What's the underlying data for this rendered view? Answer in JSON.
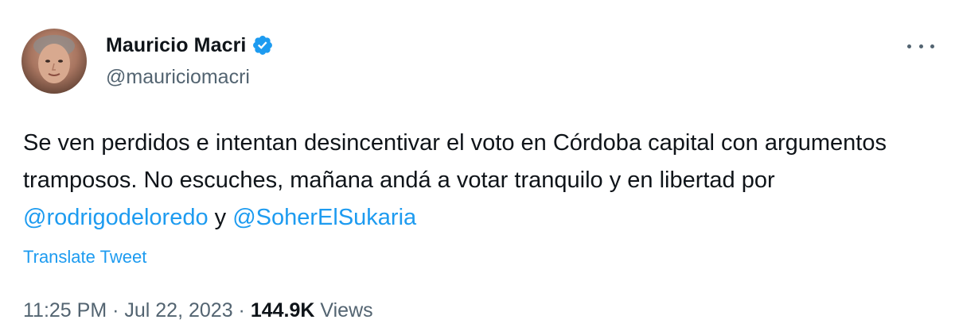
{
  "author": {
    "display_name": "Mauricio Macri",
    "handle": "@mauriciomacri",
    "verified_icon": "verified-badge-icon",
    "avatar": "avatar-photo"
  },
  "menu": {
    "icon": "more-options-icon"
  },
  "tweet": {
    "text_part1": "Se ven perdidos e intentan desincentivar el voto en Córdoba capital con argumentos tramposos. No escuches, mañana andá a votar tranquilo y en libertad por ",
    "mention1": "@rodrigodeloredo",
    "text_part2": " y ",
    "mention2": "@SoherElSukaria",
    "translate_label": "Translate Tweet"
  },
  "meta": {
    "time": "11:25 PM",
    "separator1": " · ",
    "date": "Jul 22, 2023",
    "separator2": " · ",
    "views_count": "144.9K",
    "views_label": " Views"
  },
  "colors": {
    "text": "#0f1419",
    "secondary": "#536471",
    "link": "#1d9bf0",
    "verified": "#1d9bf0"
  }
}
